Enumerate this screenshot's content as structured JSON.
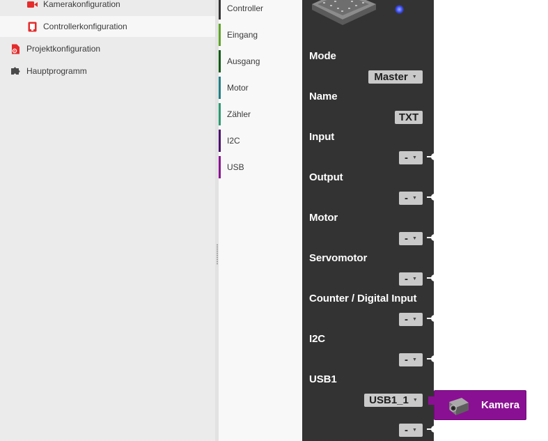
{
  "nav": {
    "items": [
      {
        "label": "Kamerakonfiguration",
        "icon": "video-camera-icon"
      },
      {
        "label": "Controllerkonfiguration",
        "icon": "controller-icon"
      },
      {
        "label": "Projektkonfiguration",
        "icon": "project-config-icon"
      },
      {
        "label": "Hauptprogramm",
        "icon": "puzzle-icon"
      }
    ]
  },
  "categories": [
    {
      "label": "Controller",
      "color": "#333333"
    },
    {
      "label": "Eingang",
      "color": "#5ba524"
    },
    {
      "label": "Ausgang",
      "color": "#0a5a14"
    },
    {
      "label": "Motor",
      "color": "#1f7f86"
    },
    {
      "label": "Zähler",
      "color": "#2a9a72"
    },
    {
      "label": "I2C",
      "color": "#4b0a6e"
    },
    {
      "label": "USB",
      "color": "#8a1093"
    }
  ],
  "block": {
    "fields": {
      "mode": {
        "label": "Mode",
        "value": "Master"
      },
      "name": {
        "label": "Name",
        "value": "TXT"
      },
      "input": {
        "label": "Input",
        "value": "-"
      },
      "output": {
        "label": "Output",
        "value": "-"
      },
      "motor": {
        "label": "Motor",
        "value": "-"
      },
      "servo": {
        "label": "Servomotor",
        "value": "-"
      },
      "counter": {
        "label": "Counter / Digital Input",
        "value": "-"
      },
      "i2c": {
        "label": "I2C",
        "value": "-"
      },
      "usb1": {
        "label": "USB1",
        "value": "USB1_1"
      },
      "last": {
        "value": "-"
      }
    },
    "camera_block": {
      "label": "Kamera",
      "icon": "camera-icon"
    }
  },
  "colors": {
    "nav_bg": "#ebebeb",
    "block_bg": "#333333",
    "usb_purple": "#8a1093",
    "accent_red": "#e02020",
    "led_blue": "#3b4dff"
  }
}
